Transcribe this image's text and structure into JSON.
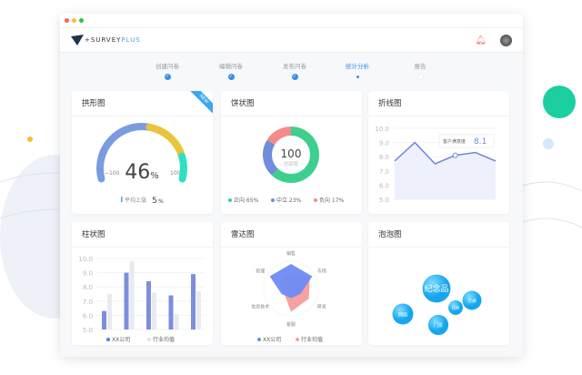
{
  "window": {
    "dots": [
      "#fe5f57",
      "#febc2e",
      "#28c840"
    ]
  },
  "header": {
    "logo_main": "SURVEY",
    "logo_accent": "PLUS"
  },
  "steps": [
    {
      "label": "创建问卷",
      "state": "done"
    },
    {
      "label": "编辑问卷",
      "state": "done"
    },
    {
      "label": "发布问卷",
      "state": "done"
    },
    {
      "label": "统计分析",
      "state": "active"
    },
    {
      "label": "报告",
      "state": "todo"
    }
  ],
  "cards": {
    "gauge": "拱形图",
    "pie": "饼状图",
    "line": "折线图",
    "bar": "柱状图",
    "radar": "雷达图",
    "bubble": "泡泡图"
  },
  "ribbon": "NEW",
  "chart_data": [
    {
      "type": "gauge",
      "value": 46,
      "unit": "%",
      "min": -100,
      "max": 100,
      "min_label": "−100",
      "max_label": "100",
      "footer_label": "平均上涨",
      "footer_value": "5",
      "footer_unit": "%",
      "colors": [
        "#7b9be0",
        "#e9c53b",
        "#2fe0c3"
      ]
    },
    {
      "type": "pie",
      "center_value": "100",
      "center_label": "总回答",
      "slices": [
        {
          "name": "正向",
          "value": 65,
          "label": "65%",
          "color": "#3ecf8e"
        },
        {
          "name": "中立",
          "value": 23,
          "label": "23%",
          "color": "#6f8ddb"
        },
        {
          "name": "负向",
          "value": 17,
          "label": "17%",
          "color": "#f48b8b"
        }
      ]
    },
    {
      "type": "line",
      "ylim": [
        5,
        10
      ],
      "yticks": [
        "10.0",
        "9.0",
        "8.0",
        "7.0",
        "6.0",
        "5.0"
      ],
      "x": [
        0,
        1,
        2,
        3,
        4,
        5
      ],
      "values": [
        7.7,
        9.0,
        7.5,
        8.1,
        8.3,
        7.7
      ],
      "highlight_index": 3,
      "tooltip_label": "客户满意度",
      "tooltip_value": "8.1"
    },
    {
      "type": "bar",
      "ylim": [
        5,
        10
      ],
      "yticks": [
        "10.0",
        "9.0",
        "8.0",
        "7.0",
        "6.0",
        "5.0"
      ],
      "series": [
        {
          "name": "XX公司",
          "values": [
            6.3,
            9.0,
            8.4,
            7.4,
            8.9
          ],
          "color": "#7b8fdc"
        },
        {
          "name": "行业均值",
          "values": [
            7.5,
            9.8,
            7.6,
            6.1,
            7.7
          ],
          "color": "#e8eaf0"
        }
      ]
    },
    {
      "type": "radar",
      "axes": [
        "销售",
        "市场",
        "研发",
        "客服",
        "信息技术",
        "管理"
      ],
      "series": [
        {
          "name": "XX公司",
          "values": [
            0.9,
            0.9,
            0.4,
            0.35,
            0.4,
            0.9
          ],
          "color": "#6d8cf5"
        },
        {
          "name": "行业均值",
          "values": [
            0.6,
            0.8,
            0.75,
            0.85,
            0.3,
            0.5
          ],
          "color": "#f7a1a1"
        }
      ]
    },
    {
      "type": "bubble",
      "bubbles": [
        {
          "label": "纪念品",
          "size": 5
        },
        {
          "label": "网络",
          "size": 2.5
        },
        {
          "label": "门票",
          "size": 2.3
        },
        {
          "label": "住宿",
          "size": 1
        },
        {
          "label": "交通",
          "size": 2
        }
      ]
    }
  ]
}
